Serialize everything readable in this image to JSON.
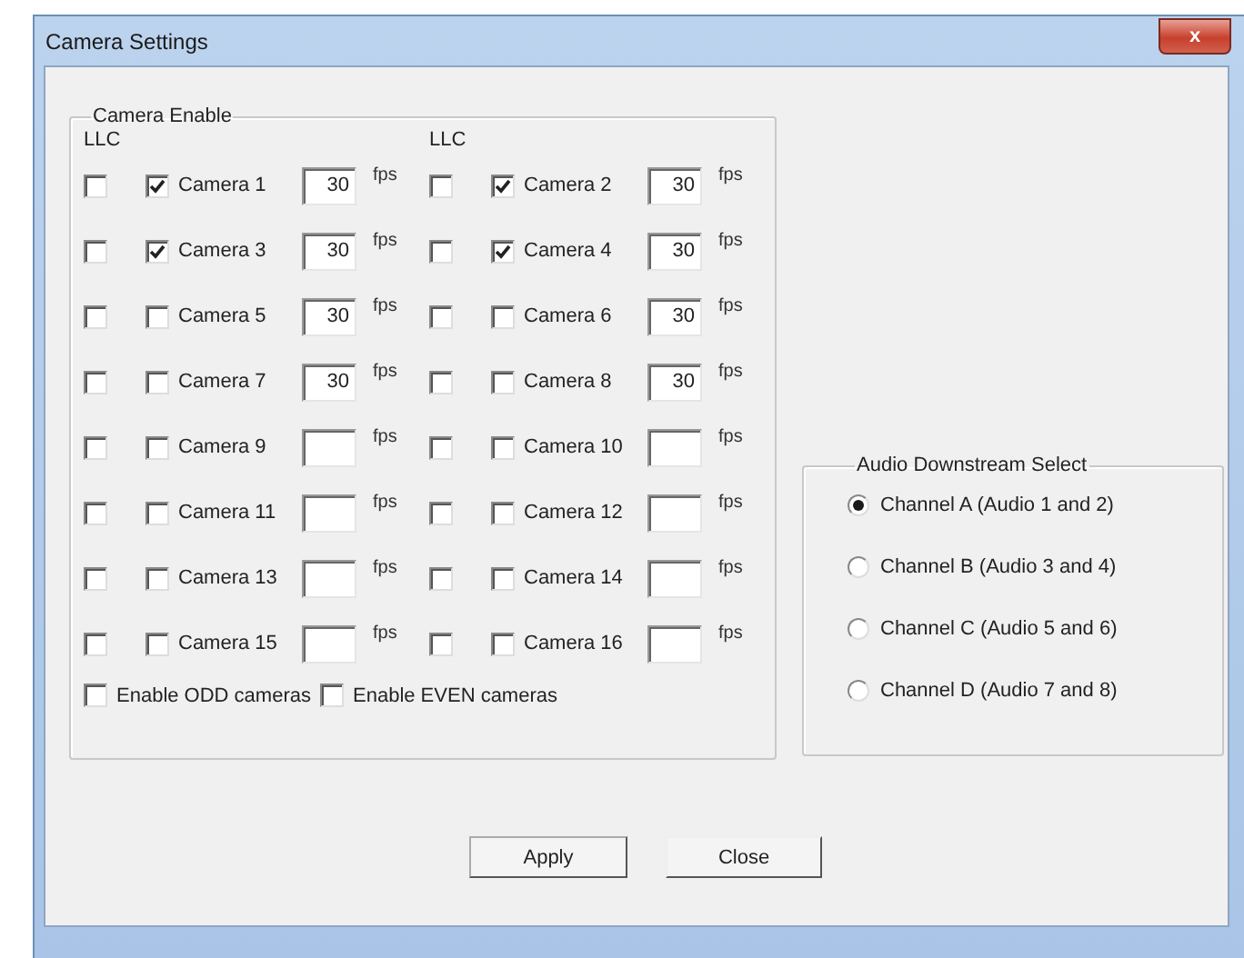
{
  "window": {
    "title": "Camera Settings",
    "close_glyph": "x"
  },
  "camera_group": {
    "title": "Camera Enable",
    "llc_headers": [
      "LLC",
      "LLC"
    ],
    "cameras": [
      {
        "llc": false,
        "checked": true,
        "label": "Camera 1",
        "value": "30",
        "unit": "fps"
      },
      {
        "llc": false,
        "checked": true,
        "label": "Camera 2",
        "value": "30",
        "unit": "fps"
      },
      {
        "llc": false,
        "checked": true,
        "label": "Camera 3",
        "value": "30",
        "unit": "fps"
      },
      {
        "llc": false,
        "checked": true,
        "label": "Camera 4",
        "value": "30",
        "unit": "fps"
      },
      {
        "llc": false,
        "checked": false,
        "label": "Camera 5",
        "value": "30",
        "unit": "fps"
      },
      {
        "llc": false,
        "checked": false,
        "label": "Camera 6",
        "value": "30",
        "unit": "fps"
      },
      {
        "llc": false,
        "checked": false,
        "label": "Camera 7",
        "value": "30",
        "unit": "fps"
      },
      {
        "llc": false,
        "checked": false,
        "label": "Camera 8",
        "value": "30",
        "unit": "fps"
      },
      {
        "llc": false,
        "checked": false,
        "label": "Camera 9",
        "unit": "fps"
      },
      {
        "llc": false,
        "checked": false,
        "label": "Camera 10",
        "unit": "fps"
      },
      {
        "llc": false,
        "checked": false,
        "label": "Camera 11",
        "unit": "fps"
      },
      {
        "llc": false,
        "checked": false,
        "label": "Camera 12",
        "unit": "fps"
      },
      {
        "llc": false,
        "checked": false,
        "label": "Camera 13",
        "unit": "fps"
      },
      {
        "llc": false,
        "checked": false,
        "label": "Camera 14",
        "unit": "fps"
      },
      {
        "llc": false,
        "checked": false,
        "label": "Camera 15",
        "unit": "fps"
      },
      {
        "llc": false,
        "checked": false,
        "label": "Camera 16",
        "unit": "fps"
      }
    ],
    "bulk_options": [
      {
        "label": "Enable ODD cameras",
        "checked": false
      },
      {
        "label": "Enable EVEN cameras",
        "checked": false
      }
    ]
  },
  "audio_group": {
    "title": "Audio Downstream Select",
    "channels": [
      {
        "label": "Channel A (Audio 1 and 2)",
        "selected": true
      },
      {
        "label": "Channel B (Audio 3 and 4)",
        "selected": false
      },
      {
        "label": "Channel C (Audio 5 and 6)",
        "selected": false
      },
      {
        "label": "Channel D (Audio 7 and 8)",
        "selected": false
      }
    ]
  },
  "buttons": [
    {
      "label": "Apply"
    },
    {
      "label": "Close"
    }
  ]
}
